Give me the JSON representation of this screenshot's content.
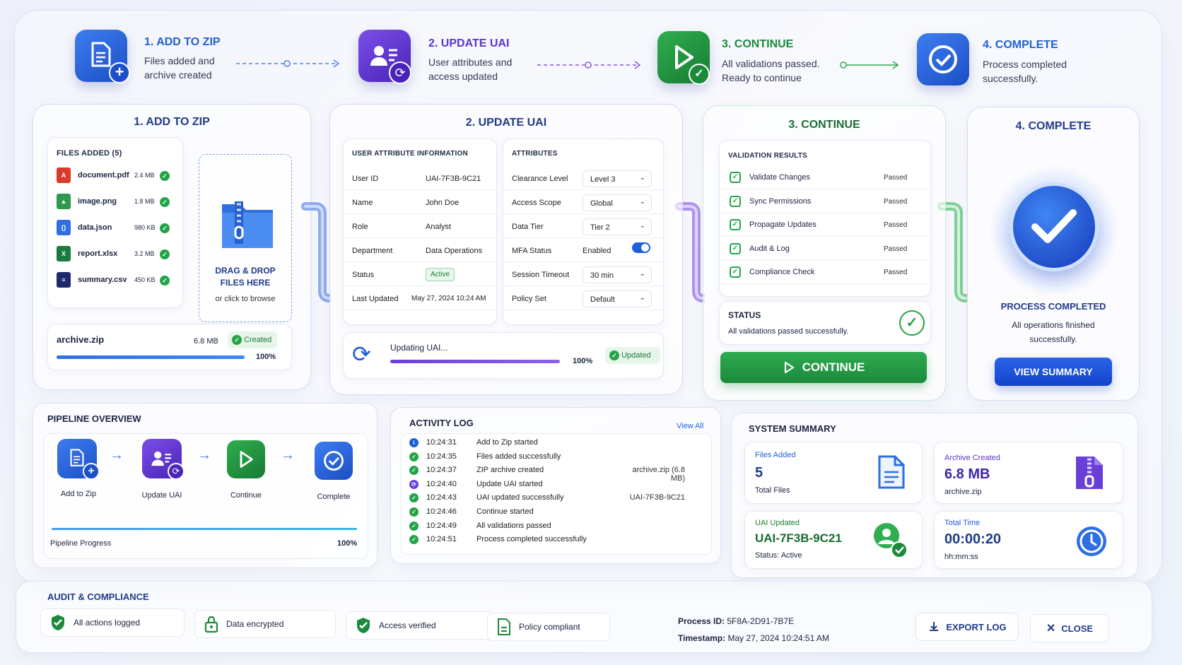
{
  "steps": [
    {
      "title": "1. ADD TO ZIP",
      "desc1": "Files added and",
      "desc2": "archive created",
      "color": "#1f5fd6"
    },
    {
      "title": "2. UPDATE UAI",
      "desc1": "User attributes and",
      "desc2": "access updated",
      "color": "#5a34c9"
    },
    {
      "title": "3. CONTINUE",
      "desc1": "All validations passed.",
      "desc2": "Ready to continue",
      "color": "#1b8a3a"
    },
    {
      "title": "4. COMPLETE",
      "desc1": "Process completed",
      "desc2": "successfully.",
      "color": "#1f5fd6"
    }
  ],
  "zip": {
    "title": "1. ADD TO ZIP",
    "files_header": "FILES ADDED (5)",
    "files": [
      {
        "name": "document.pdf",
        "size": "2.4 MB",
        "icon": "pdf-icon"
      },
      {
        "name": "image.png",
        "size": "1.8 MB",
        "icon": "image-icon"
      },
      {
        "name": "data.json",
        "size": "980 KB",
        "icon": "json-icon"
      },
      {
        "name": "report.xlsx",
        "size": "3.2 MB",
        "icon": "excel-icon"
      },
      {
        "name": "summary.csv",
        "size": "450 KB",
        "icon": "csv-icon"
      }
    ],
    "drop_line1": "DRAG & DROP",
    "drop_line2": "FILES HERE",
    "drop_sub": "or click to browse",
    "archive_name": "archive.zip",
    "archive_size": "6.8 MB",
    "archive_status": "Created",
    "progress_label": "100%",
    "progress": 1.0
  },
  "uai": {
    "title": "2. UPDATE UAI",
    "info_header": "USER ATTRIBUTE INFORMATION",
    "info": [
      {
        "label": "User ID",
        "value": "UAI-7F3B-9C21"
      },
      {
        "label": "Name",
        "value": "John Doe"
      },
      {
        "label": "Role",
        "value": "Analyst"
      },
      {
        "label": "Department",
        "value": "Data Operations"
      },
      {
        "label": "Status",
        "value": "Active"
      },
      {
        "label": "Last Updated",
        "value": "May 27, 2024 10:24 AM"
      }
    ],
    "attr_header": "ATTRIBUTES",
    "attrs": [
      {
        "label": "Clearance Level",
        "value": "Level 3"
      },
      {
        "label": "Access Scope",
        "value": "Global"
      },
      {
        "label": "Data Tier",
        "value": "Tier 2"
      },
      {
        "label": "MFA Status",
        "value": "Enabled"
      },
      {
        "label": "Session Timeout",
        "value": "30 min"
      },
      {
        "label": "Policy Set",
        "value": "Default"
      }
    ],
    "updating_label": "Updating UAI...",
    "progress_label": "100%",
    "progress": 1.0,
    "status": "Updated"
  },
  "cont": {
    "title": "3. CONTINUE",
    "val_header": "VALIDATION RESULTS",
    "validations": [
      {
        "name": "Validate Changes",
        "result": "Passed"
      },
      {
        "name": "Sync Permissions",
        "result": "Passed"
      },
      {
        "name": "Propagate Updates",
        "result": "Passed"
      },
      {
        "name": "Audit & Log",
        "result": "Passed"
      },
      {
        "name": "Compliance Check",
        "result": "Passed"
      }
    ],
    "status_title": "STATUS",
    "status_text": "All validations passed successfully.",
    "button": "CONTINUE"
  },
  "complete": {
    "title": "4. COMPLETE",
    "heading": "PROCESS COMPLETED",
    "text1": "All operations finished",
    "text2": "successfully.",
    "button": "VIEW SUMMARY"
  },
  "pipeline": {
    "title": "PIPELINE OVERVIEW",
    "stages": [
      "Add to Zip",
      "Update UAI",
      "Continue",
      "Complete"
    ],
    "progress_label": "Pipeline Progress",
    "progress_value": "100%",
    "progress": 1.0
  },
  "activity": {
    "title": "ACTIVITY LOG",
    "view_all": "View All",
    "entries": [
      {
        "time": "10:24:31",
        "msg": "Add to Zip started",
        "ref": "",
        "kind": "info"
      },
      {
        "time": "10:24:35",
        "msg": "Files added successfully",
        "ref": "",
        "kind": "ok"
      },
      {
        "time": "10:24:37",
        "msg": "ZIP archive created",
        "ref": "archive.zip (6.8 MB)",
        "kind": "ok"
      },
      {
        "time": "10:24:40",
        "msg": "Update UAI started",
        "ref": "",
        "kind": "purple"
      },
      {
        "time": "10:24:43",
        "msg": "UAI updated successfully",
        "ref": "UAI-7F3B-9C21",
        "kind": "ok"
      },
      {
        "time": "10:24:46",
        "msg": "Continue started",
        "ref": "",
        "kind": "ok"
      },
      {
        "time": "10:24:49",
        "msg": "All validations passed",
        "ref": "",
        "kind": "ok"
      },
      {
        "time": "10:24:51",
        "msg": "Process completed successfully",
        "ref": "",
        "kind": "ok"
      }
    ]
  },
  "summary": {
    "title": "SYSTEM SUMMARY",
    "files_label": "Files Added",
    "files_value": "5",
    "files_sub": "Total Files",
    "archive_label": "Archive Created",
    "archive_value": "6.8 MB",
    "archive_sub": "archive.zip",
    "uai_label": "UAI Updated",
    "uai_value": "UAI-7F3B-9C21",
    "uai_sub": "Status: Active",
    "time_label": "Total Time",
    "time_value": "00:00:20",
    "time_sub": "hh:mm:ss"
  },
  "audit": {
    "title": "AUDIT & COMPLIANCE",
    "items": [
      "All actions logged",
      "Data encrypted",
      "Access verified",
      "Policy compliant"
    ],
    "process_label": "Process ID:",
    "process_value": "5F8A-2D91-7B7E",
    "timestamp_label": "Timestamp:",
    "timestamp_value": "May 27, 2024 10:24:51 AM",
    "export": "EXPORT LOG",
    "close": "CLOSE"
  }
}
